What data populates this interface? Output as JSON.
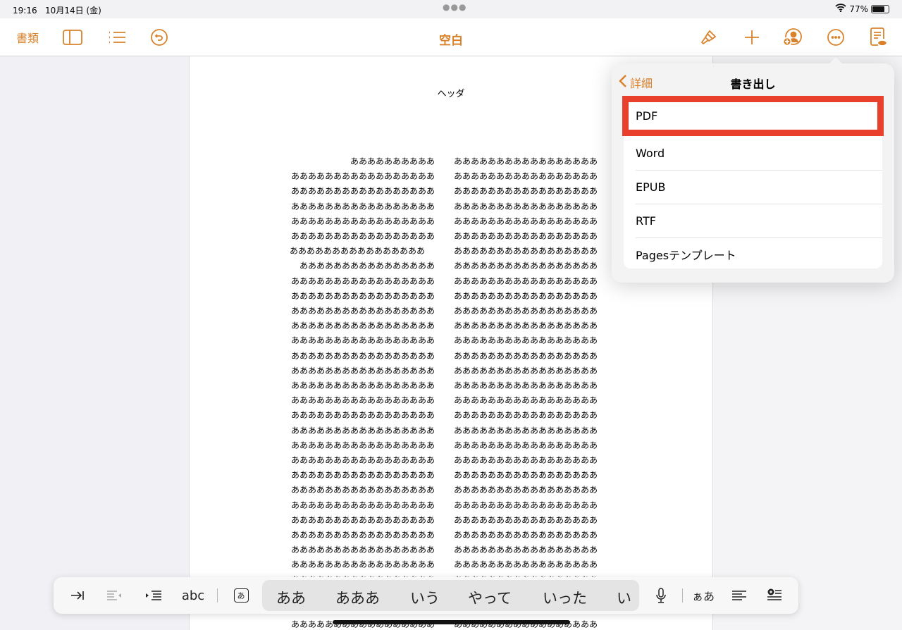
{
  "status": {
    "time": "19:16",
    "date": "10月14日 (金)",
    "battery": "77%",
    "battery_level": 0.77
  },
  "toolbar": {
    "documents": "書類",
    "title": "空白",
    "icons": [
      "sidebar-icon",
      "list-icon",
      "undo-icon",
      "paintbrush-icon",
      "plus-icon",
      "collaborate-icon",
      "more-icon",
      "reader-view-icon"
    ]
  },
  "document": {
    "header": "ヘッダ",
    "left_lines": [
      "ああああああああああ",
      "あああああああああああああああああ",
      "あああああああああああああああああ",
      "あああああああああああああああああ",
      "あああああああああああああああああ",
      "あああああああああああああああああ",
      "ああああああああああああああああ",
      "ああああああああああああああああ",
      "あああああああああああああああああ",
      "あああああああああああああああああ",
      "あああああああああああああああああ",
      "あああああああああああああああああ",
      "あああああああああああああああああ",
      "あああああああああああああああああ",
      "あああああああああああああああああ",
      "あああああああああああああああああ",
      "あああああああああああああああああ",
      "あああああああああああああああああ",
      "あああああああああああああああああ",
      "あああああああああああああああああ",
      "あああああああああああああああああ",
      "あああああああああああああああああ",
      "あああああああああああああああああ",
      "あああああああああああああああああ",
      "あああああああああああああああああ",
      "あああああああああああああああああ",
      "あああああああああああああああああ",
      "あああああああああああああああああ",
      "あああああああああああああああああ",
      "あああああああああああああああああ",
      "あああああああああああああああああ",
      "あああああああああああああああああ"
    ],
    "right_lines": [
      "あああああああああああああああああ",
      "あああああああああああああああああ",
      "あああああああああああああああああ",
      "あああああああああああああああああ",
      "あああああああああああああああああ",
      "あああああああああああああああああ",
      "あああああああああああああああああ",
      "あああああああああああああああああ",
      "あああああああああああああああああ",
      "あああああああああああああああああ",
      "あああああああああああああああああ",
      "あああああああああああああああああ",
      "あああああああああああああああああ",
      "あああああああああああああああああ",
      "あああああああああああああああああ",
      "あああああああああああああああああ",
      "あああああああああああああああああ",
      "あああああああああああああああああ",
      "あああああああああああああああああ",
      "あああああああああああああああああ",
      "あああああああああああああああああ",
      "あああああああああああああああああ",
      "あああああああああああああああああ",
      "あああああああああああああああああ",
      "あああああああああああああああああ",
      "あああああああああああああああああ",
      "あああああああああああああああああ",
      "あああああああああああああああああ",
      "あああああああああああああああああ",
      "あああああああああああああああああ",
      "あああああああああああああああああ",
      "あああああああああああああああああ"
    ]
  },
  "popover": {
    "back": "詳細",
    "title": "書き出し",
    "items": [
      "PDF",
      "Word",
      "EPUB",
      "RTF",
      "Pagesテンプレート"
    ],
    "highlight_color": "#e8402a"
  },
  "keyboard_bar": {
    "abc": "abc",
    "kana_key": "あ",
    "suggestions": [
      "ああ",
      "あああ",
      "いう",
      "やって",
      "いった",
      "い"
    ],
    "case": "ぁあ"
  },
  "accent": "#d9822b"
}
